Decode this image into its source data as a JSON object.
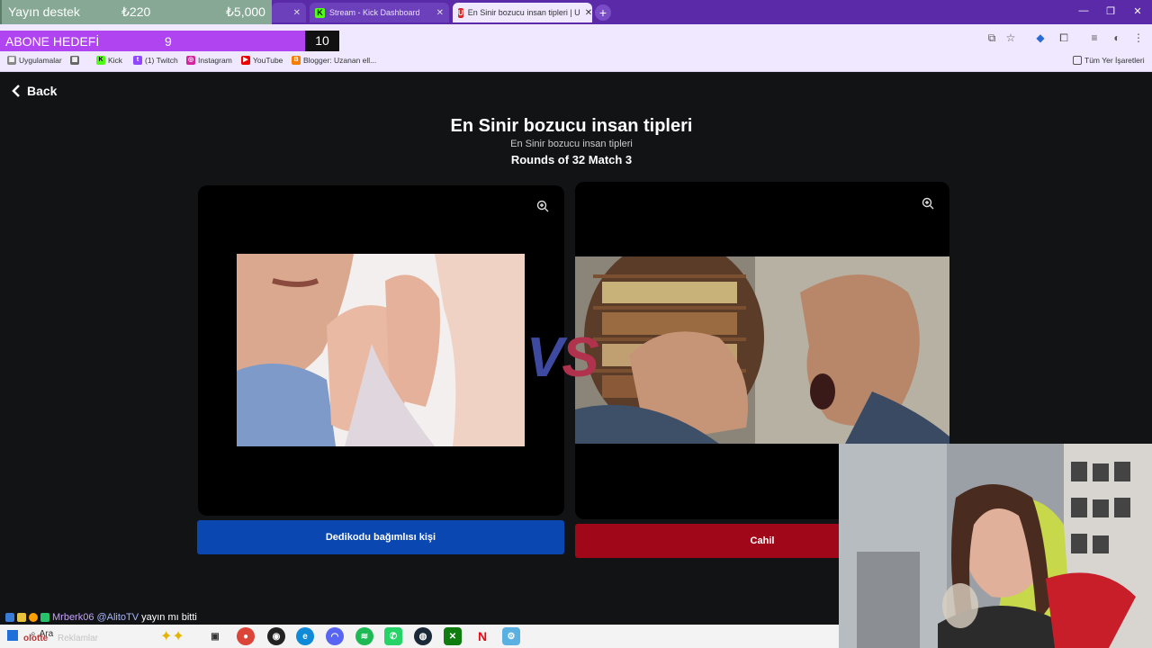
{
  "overlays": {
    "support": {
      "label": "Yayın destek",
      "current": "₺220",
      "target": "₺5,000"
    },
    "sub_goal": {
      "label": "ABONE HEDEFİ",
      "current": "9",
      "target": "10"
    }
  },
  "browser": {
    "tabs": [
      {
        "label": "",
        "state": "partial"
      },
      {
        "label": "Stream - Kick Dashboard",
        "state": "inactive"
      },
      {
        "label": "En Sinir bozucu insan tipleri | U",
        "state": "active"
      }
    ],
    "bookmarks": [
      "Uygulamalar",
      "Kick",
      "(1) Twitch",
      "Instagram",
      "YouTube",
      "Blogger: Uzanan ell...",
      "Tüm Yer İşaretleri"
    ]
  },
  "page": {
    "back_label": "Back",
    "title": "En Sinir bozucu insan tipleri",
    "subtitle": "En Sinir bozucu insan tipleri",
    "round": "Rounds of 32 Match 3",
    "vs_v": "V",
    "vs_s": "S",
    "left_choice": "Dedikodu bağımlısı kişi",
    "right_choice": "Cahil"
  },
  "taskbar": {
    "search": "Ara",
    "overlay_text": "olotte",
    "overlay_text2": "Reklamlar"
  },
  "chat": {
    "user": "Mrberk06",
    "mention": "@AlitoTV",
    "message": "yayın mı bitti"
  },
  "colors": {
    "purple_chrome": "#5a2aa8",
    "left_button": "#0a47b0",
    "right_button": "#a0081a",
    "sub_goal": "#b044f1",
    "support": "#86a894"
  }
}
